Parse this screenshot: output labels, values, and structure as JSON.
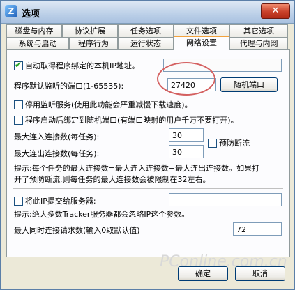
{
  "window": {
    "title": "选项",
    "close_label": "✕"
  },
  "tabs": {
    "row1": [
      "磁盘与内存",
      "协议扩展",
      "任务选项",
      "文件选项",
      "其它选项"
    ],
    "row2": [
      "系统与启动",
      "程序行为",
      "运行状态",
      "网络设置",
      "代理与内网"
    ],
    "active": "网络设置"
  },
  "options": {
    "auto_ip": {
      "label": "自动取得程序绑定的本机IP地址。",
      "checked": true,
      "value": ""
    },
    "port_label": "程序默认监听的端口(1-65535):",
    "port_value": "27420",
    "random_port_button": "随机端口",
    "disable_listen": {
      "label": "停用监听服务(使用此功能会严重减慢下载速度)。",
      "checked": false
    },
    "bind_random": {
      "label": "程序启动后绑定到随机端口(有端口映射的用户千万不要打开)。",
      "checked": false
    },
    "max_in_label": "最大连入连接数(每任务):",
    "max_in_value": "30",
    "max_out_label": "最大连出连接数(每任务):",
    "max_out_value": "30",
    "prevent_drop": {
      "label": "预防断流",
      "checked": false
    },
    "hint1_line1": "提示:每个任务的最大连接数=最大连入连接数+最大连出连接数。如果打",
    "hint1_line2": "开了预防断流,则每任务的最大连接数会被限制在32左右。",
    "submit_ip": {
      "label": "将此IP提交给服务器:",
      "checked": false,
      "value": ""
    },
    "hint2": "提示:绝大多数Tracker服务器都会忽略IP这个参数。",
    "max_requests_label": "最大同时连接请求数(输入0取默认值)",
    "max_requests_value": "72"
  },
  "footer": {
    "ok": "确定",
    "cancel": "取消",
    "watermark": "PConline.com.cn"
  },
  "colors": {
    "accent_tab": "#f2a23d",
    "annotation": "#d46060"
  }
}
